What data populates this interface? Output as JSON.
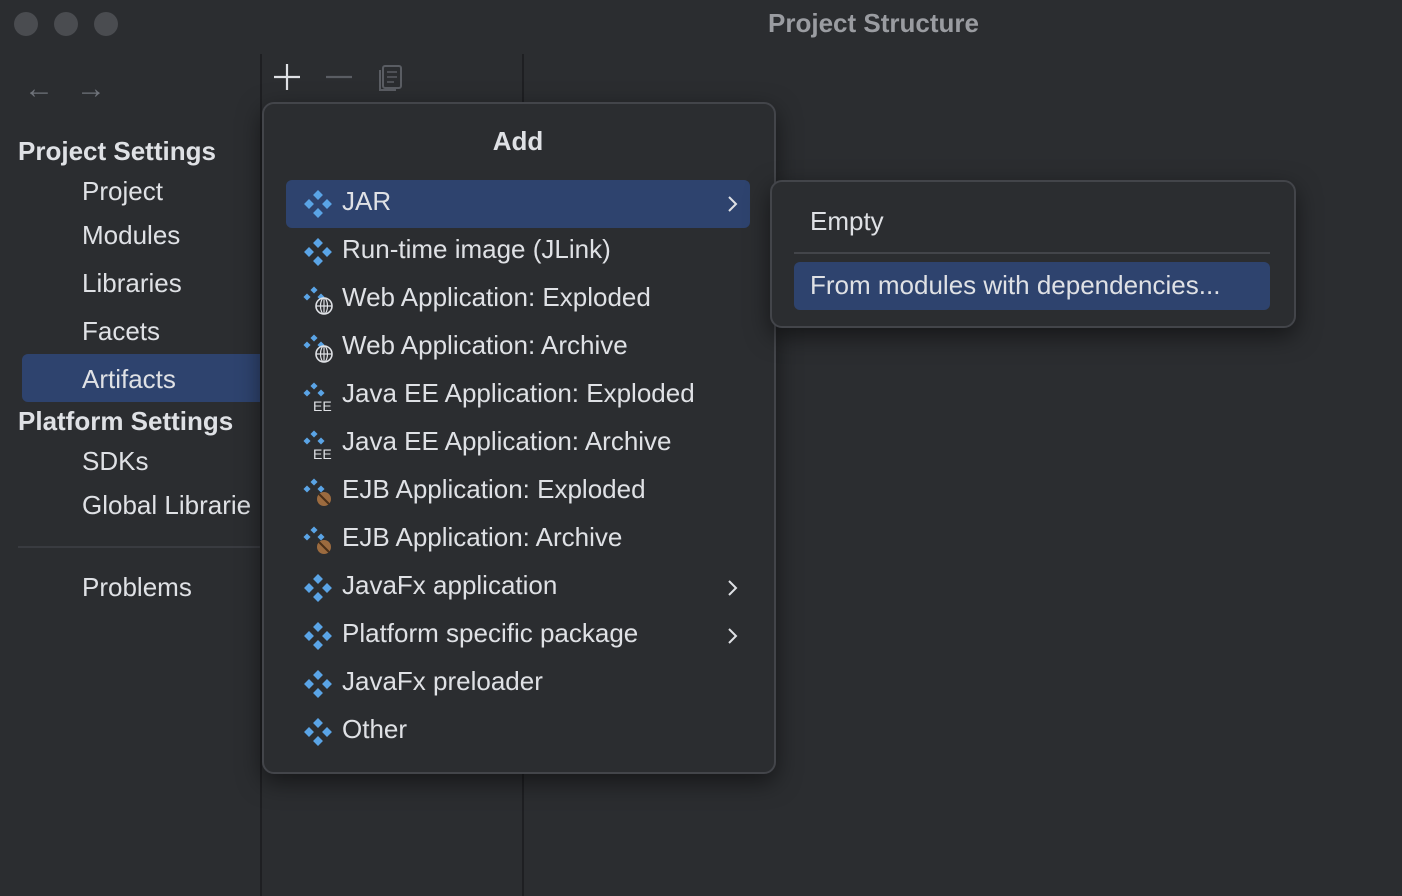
{
  "window": {
    "title": "Project Structure"
  },
  "nav": {
    "back_icon": "←",
    "forward_icon": "→"
  },
  "sidebar": {
    "project_settings_header": "Project Settings",
    "project_items": [
      "Project",
      "Modules",
      "Libraries",
      "Facets",
      "Artifacts"
    ],
    "selected_item": "Artifacts",
    "platform_settings_header": "Platform Settings",
    "platform_items": [
      "SDKs",
      "Global Librarie"
    ],
    "problems": "Problems"
  },
  "toolbar": {
    "add": "plus-icon",
    "remove": "minus-icon",
    "copy": "copy-icon"
  },
  "add_popup": {
    "title": "Add",
    "items": [
      {
        "label": "JAR",
        "icon": "artifact-icon",
        "submenu": true,
        "selected": true
      },
      {
        "label": "Run-time image (JLink)",
        "icon": "artifact-icon",
        "submenu": false
      },
      {
        "label": "Web Application: Exploded",
        "icon": "web-artifact-icon",
        "submenu": false
      },
      {
        "label": "Web Application: Archive",
        "icon": "web-artifact-icon",
        "submenu": false
      },
      {
        "label": "Java EE Application: Exploded",
        "icon": "javaee-artifact-icon",
        "submenu": false
      },
      {
        "label": "Java EE Application: Archive",
        "icon": "javaee-artifact-icon",
        "submenu": false
      },
      {
        "label": "EJB Application: Exploded",
        "icon": "ejb-artifact-icon",
        "submenu": false
      },
      {
        "label": "EJB Application: Archive",
        "icon": "ejb-artifact-icon",
        "submenu": false
      },
      {
        "label": "JavaFx application",
        "icon": "artifact-icon",
        "submenu": true
      },
      {
        "label": "Platform specific package",
        "icon": "artifact-icon",
        "submenu": true
      },
      {
        "label": "JavaFx preloader",
        "icon": "artifact-icon",
        "submenu": false
      },
      {
        "label": "Other",
        "icon": "artifact-icon",
        "submenu": false
      }
    ]
  },
  "jar_submenu": {
    "items": [
      {
        "label": "Empty",
        "selected": false
      },
      {
        "label": "From modules with dependencies...",
        "selected": true
      }
    ]
  },
  "colors": {
    "background": "#2b2d30",
    "selection": "#2e436e",
    "icon_blue": "#5aa4e6",
    "text": "#dfe1e5"
  }
}
